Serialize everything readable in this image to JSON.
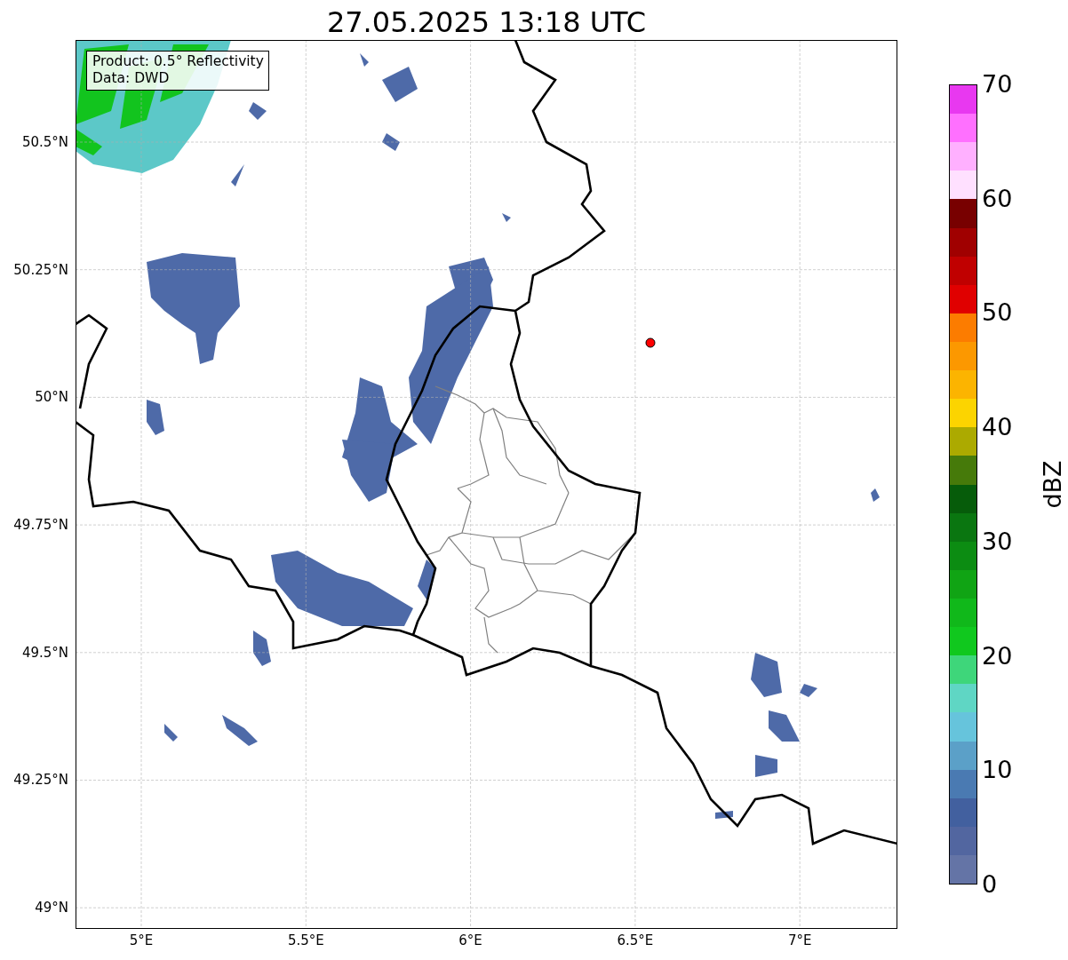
{
  "title": "27.05.2025 13:18 UTC",
  "info_box": [
    "Product: 0.5° Reflectivity",
    "Data: DWD"
  ],
  "y_ticks": [
    "50.5°N",
    "50.25°N",
    "50°N",
    "49.75°N",
    "49.5°N",
    "49.25°N",
    "49°N"
  ],
  "x_ticks": [
    "5°E",
    "5.5°E",
    "6°E",
    "6.5°E",
    "7°E"
  ],
  "colorbar": {
    "label": "dBZ",
    "ticks": [
      "70",
      "60",
      "50",
      "40",
      "30",
      "20",
      "10",
      "0"
    ],
    "bands": [
      {
        "color": "#e838f0"
      },
      {
        "color": "#ff70ff"
      },
      {
        "color": "#ffb0ff"
      },
      {
        "color": "#ffe0ff"
      },
      {
        "color": "#780000"
      },
      {
        "color": "#a00000"
      },
      {
        "color": "#c00000"
      },
      {
        "color": "#e00000"
      },
      {
        "color": "#fc7c00"
      },
      {
        "color": "#fc9800"
      },
      {
        "color": "#fcb400"
      },
      {
        "color": "#fcd400"
      },
      {
        "color": "#acaa00"
      },
      {
        "color": "#467a0a"
      },
      {
        "color": "#065c0a"
      },
      {
        "color": "#0a7610"
      },
      {
        "color": "#0c8c12"
      },
      {
        "color": "#10a414"
      },
      {
        "color": "#10b81a"
      },
      {
        "color": "#10c81e"
      },
      {
        "color": "#3ed67a"
      },
      {
        "color": "#5fd6c4"
      },
      {
        "color": "#66c4dc"
      },
      {
        "color": "#5ba0c8"
      },
      {
        "color": "#4a7ab2"
      },
      {
        "color": "#42609f"
      },
      {
        "color": "#5266a0"
      },
      {
        "color": "#6474a6"
      }
    ]
  }
}
